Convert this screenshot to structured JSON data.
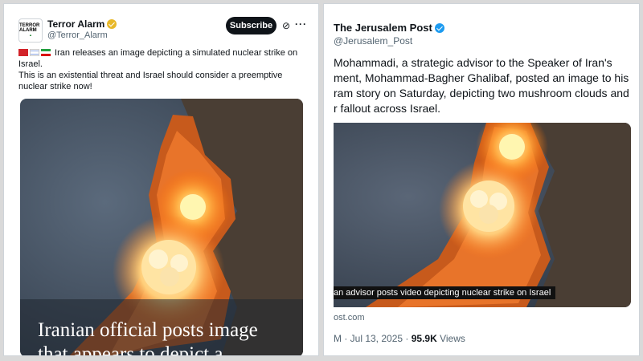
{
  "left_post": {
    "account_name": "Terror Alarm",
    "handle": "@Terror_Alarm",
    "avatar_text": "TERROR ALARM",
    "subscribe_label": "Subscribe",
    "icons": [
      "verified-badge-gold",
      "grok-icon",
      "more-icon",
      "flag-icons"
    ],
    "text_line1": " Iran releases an image depicting a simulated nuclear strike on Israel.",
    "text_line2": "This is an existential threat and Israel should consider a preemptive nuclear strike now!",
    "image_headline": "Iranian official posts image that appears to depict a",
    "colors": {
      "badge": "#e8b829",
      "button": "#0f1419"
    }
  },
  "right_post": {
    "account_name": "The Jerusalem Post",
    "handle": "@Jerusalem_Post",
    "text_lines": [
      "Mohammadi, a strategic advisor to the Speaker of Iran's",
      "ment, Mohammad-Bagher Ghalibaf, posted an image to his",
      "ram story on Saturday, depicting two mushroom clouds and",
      "r fallout across Israel."
    ],
    "image_caption": "an advisor posts video depicting nuclear strike on Israel",
    "link_domain": "ost.com",
    "meta_prefix": "M · Jul 13, 2025 · ",
    "views_count": "95.9K",
    "views_label": " Views",
    "colors": {
      "badge": "#1d9bf0"
    }
  }
}
